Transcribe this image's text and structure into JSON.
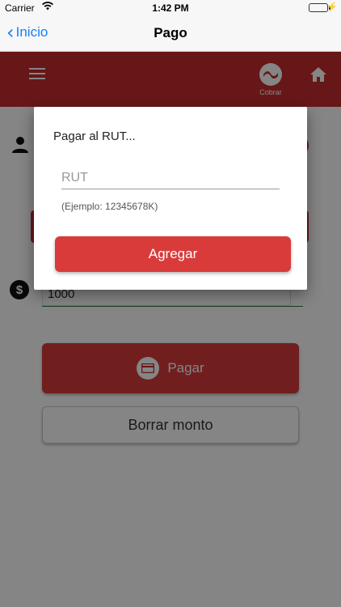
{
  "status_bar": {
    "carrier": "Carrier",
    "time": "1:42 PM"
  },
  "nav": {
    "back_label": "Inicio",
    "title": "Pago"
  },
  "app_bar": {
    "cobrar_label": "Cobrar"
  },
  "form": {
    "monto_value": "1000"
  },
  "buttons": {
    "pagar_label": "Pagar",
    "borrar_label": "Borrar monto"
  },
  "dialog": {
    "title": "Pagar al RUT...",
    "rut_placeholder": "RUT",
    "rut_value": "",
    "hint": "(Ejemplo: 12345678K)",
    "agregar_label": "Agregar"
  },
  "colors": {
    "accent": "#d93b3b",
    "appbar": "#c62d2d",
    "ios_blue": "#157efb"
  }
}
